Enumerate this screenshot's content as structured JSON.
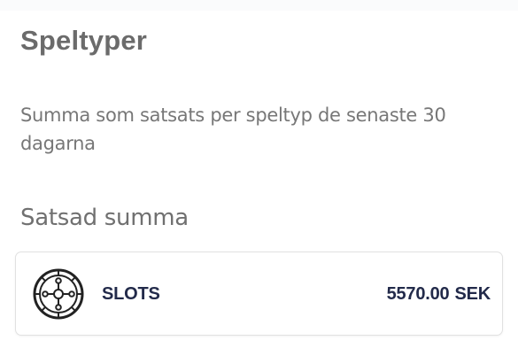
{
  "page": {
    "title": "Speltyper",
    "description": "Summa som satsats per speltyp de senaste 30 dagarna",
    "section_heading": "Satsad summa"
  },
  "game_types": [
    {
      "name": "SLOTS",
      "amount": "5570.00",
      "currency": "SEK",
      "icon": "roulette-wheel-icon"
    }
  ],
  "colors": {
    "title": "#6b6b6b",
    "body_text": "#777777",
    "card_text": "#222a4a",
    "card_border": "#e1e1e1"
  }
}
